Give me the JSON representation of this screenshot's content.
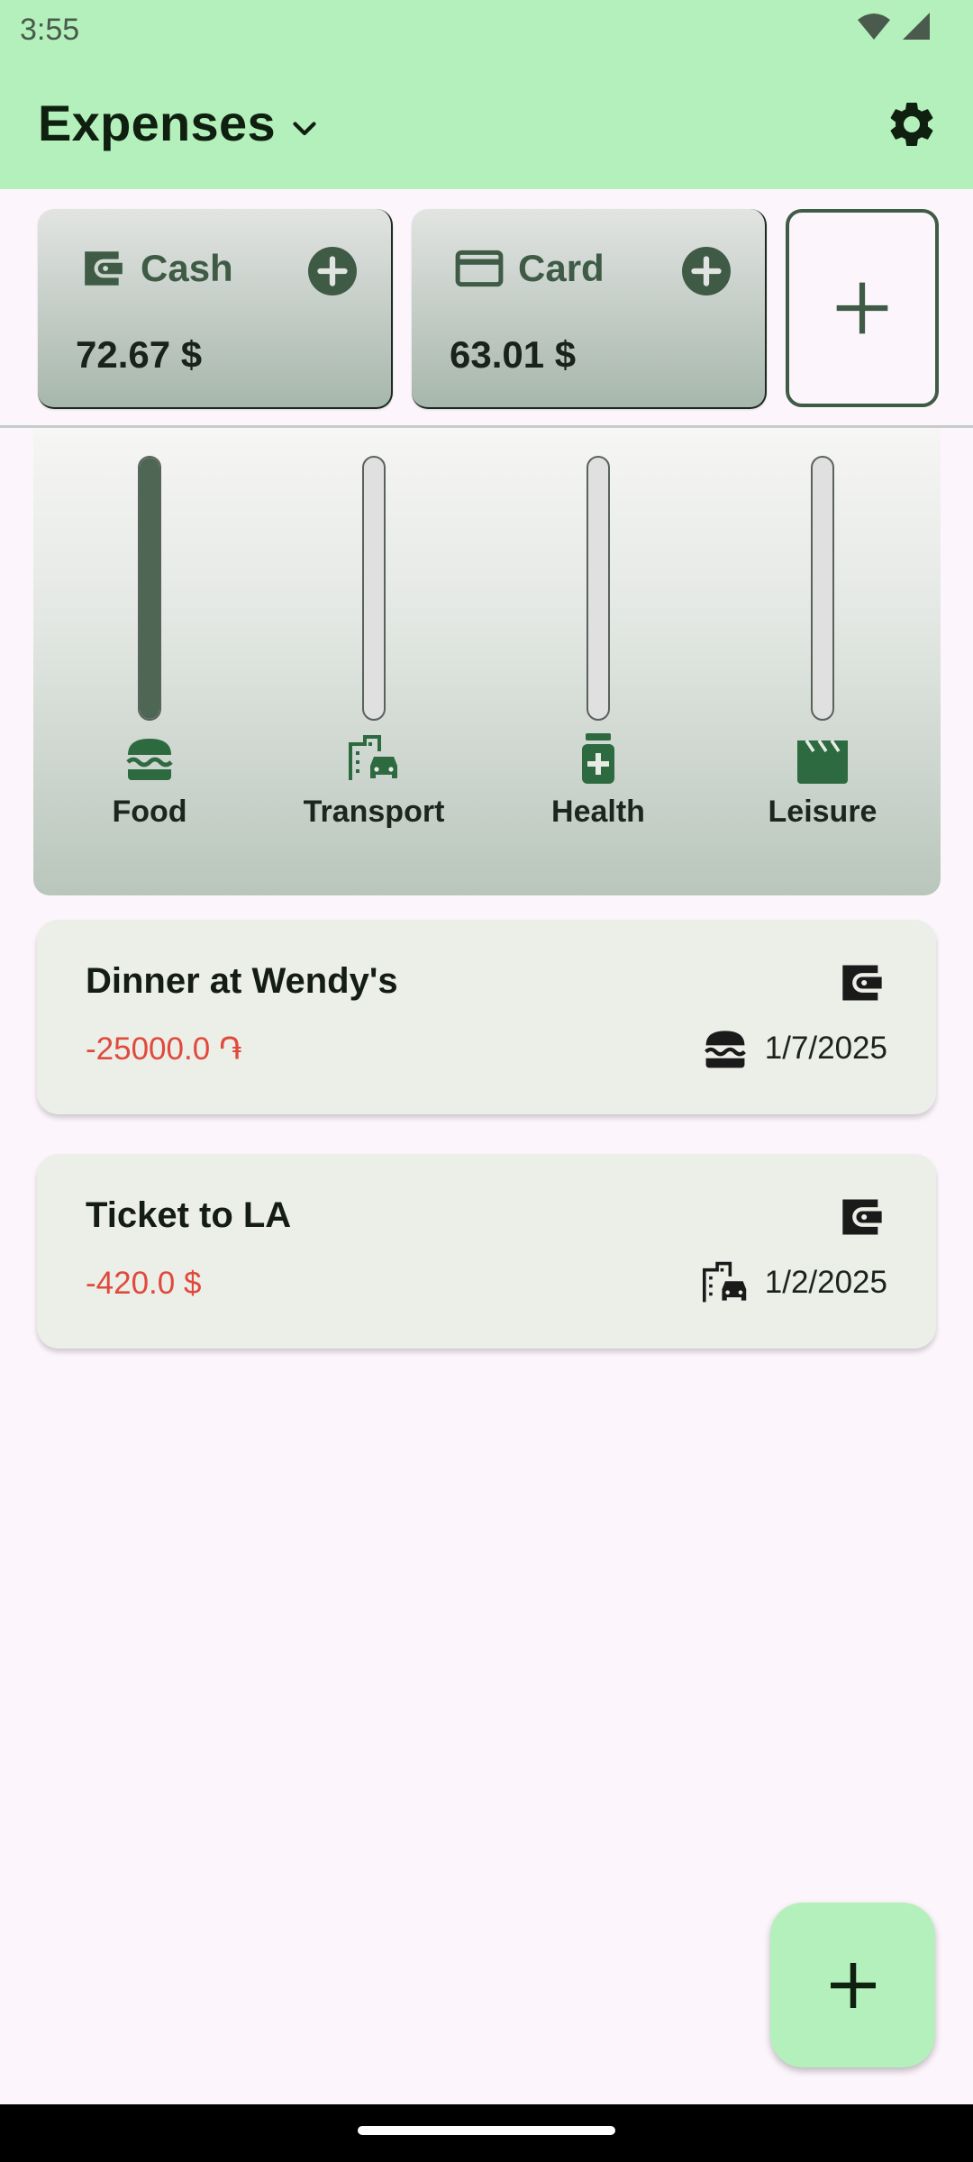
{
  "status_bar": {
    "time": "3:55"
  },
  "app_bar": {
    "title": "Expenses"
  },
  "accounts": [
    {
      "name": "Cash",
      "balance": "72.67 $",
      "icon": "wallet-icon"
    },
    {
      "name": "Card",
      "balance": "63.01 $",
      "icon": "credit-card-icon"
    }
  ],
  "categories": [
    {
      "label": "Food",
      "icon": "burger-icon",
      "level": 1.0
    },
    {
      "label": "Transport",
      "icon": "city-car-icon",
      "level": 0.0
    },
    {
      "label": "Health",
      "icon": "medication-icon",
      "level": 0.0
    },
    {
      "label": "Leisure",
      "icon": "clapperboard-icon",
      "level": 0.0
    }
  ],
  "expenses": [
    {
      "title": "Dinner at Wendy's",
      "amount": "-25000.0 ֏",
      "date": "1/7/2025",
      "category_icon": "burger-icon",
      "account_icon": "wallet-icon"
    },
    {
      "title": "Ticket to LA",
      "amount": "-420.0 $",
      "date": "1/2/2025",
      "category_icon": "city-car-icon",
      "account_icon": "wallet-icon"
    }
  ],
  "colors": {
    "app_bar_bg": "#b4f0bc",
    "accent": "#3f5b46",
    "negative_amount": "#e04a3c",
    "background": "#fcf6fc"
  }
}
